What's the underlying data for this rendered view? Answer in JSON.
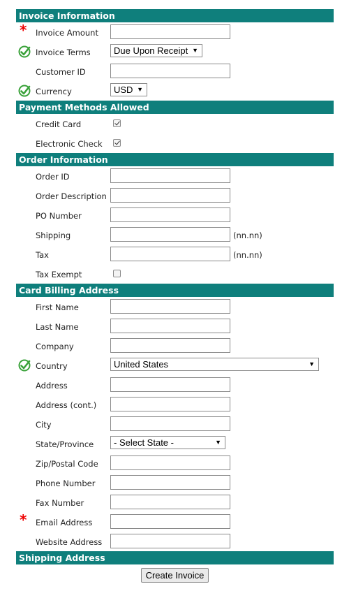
{
  "invoice_info": {
    "section_title": "Invoice Information",
    "invoice_amount_label": "Invoice Amount",
    "invoice_amount_value": "",
    "invoice_terms_label": "Invoice Terms",
    "invoice_terms_selected": "Due Upon Receipt",
    "customer_id_label": "Customer ID",
    "customer_id_value": "",
    "currency_label": "Currency",
    "currency_selected": "USD"
  },
  "payment_methods": {
    "section_title": "Payment Methods Allowed",
    "credit_card_label": "Credit Card",
    "credit_card_checked": true,
    "electronic_check_label": "Electronic Check",
    "electronic_check_checked": true
  },
  "order_info": {
    "section_title": "Order Information",
    "order_id_label": "Order ID",
    "order_description_label": "Order Description",
    "po_number_label": "PO Number",
    "shipping_label": "Shipping",
    "shipping_hint": "(nn.nn)",
    "tax_label": "Tax",
    "tax_hint": "(nn.nn)",
    "tax_exempt_label": "Tax Exempt",
    "tax_exempt_checked": false
  },
  "billing": {
    "section_title": "Card Billing Address",
    "first_name_label": "First Name",
    "last_name_label": "Last Name",
    "company_label": "Company",
    "country_label": "Country",
    "country_selected": "United States",
    "address_label": "Address",
    "address_cont_label": "Address (cont.)",
    "city_label": "City",
    "state_label": "State/Province",
    "state_selected": "- Select State -",
    "zip_label": "Zip/Postal Code",
    "phone_label": "Phone Number",
    "fax_label": "Fax Number",
    "email_label": "Email Address",
    "website_label": "Website Address"
  },
  "shipping": {
    "section_title": "Shipping Address"
  },
  "actions": {
    "create_invoice_label": "Create Invoice"
  },
  "icons": {
    "required": "required-asterisk-icon",
    "valid": "green-checkmark-icon"
  },
  "colors": {
    "section_header_bg": "#0f7f7c",
    "required_star": "#e00000",
    "valid_check": "#3aa23a"
  }
}
